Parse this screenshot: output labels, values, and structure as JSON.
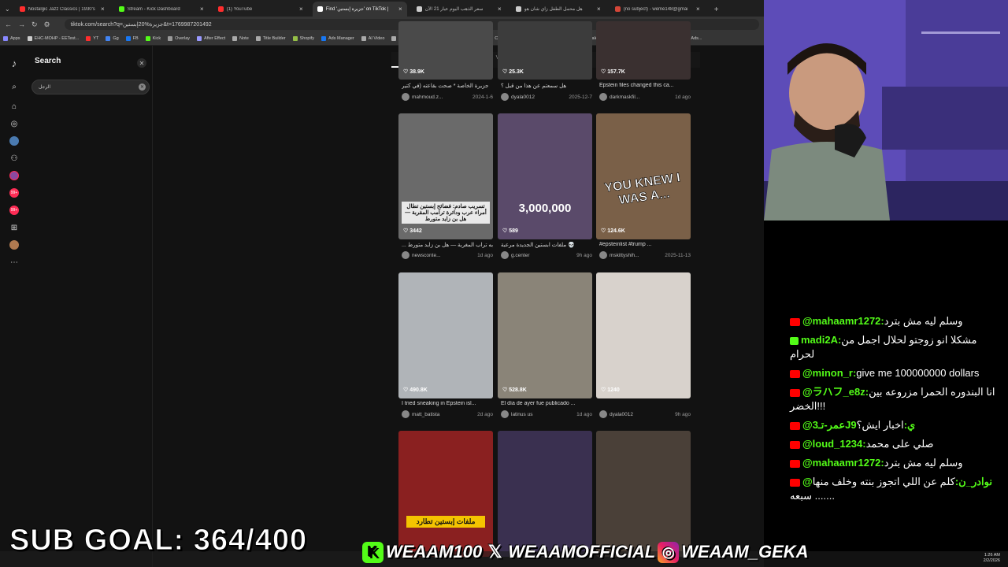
{
  "browser": {
    "tabs": [
      {
        "title": "Nostalgic Jazz Classics | 1930's",
        "color": "#ff2d2d",
        "active": false
      },
      {
        "title": "Stream - Kick Dashboard",
        "color": "#53fc18",
        "active": false
      },
      {
        "title": "(1) YouTube",
        "color": "#ff2d2d",
        "active": false
      },
      {
        "title": "Find 'جزيرة إبستين' on TikTok |",
        "color": "#ffffff",
        "active": true
      },
      {
        "title": "سعر الذهب اليوم عيار 21 الآن",
        "color": "#cccccc",
        "active": false
      },
      {
        "title": "هل محمل الطفل زاي شان هو",
        "color": "#cccccc",
        "active": false
      },
      {
        "title": "(no subject) - weme148@gmai",
        "color": "#d44638",
        "active": false
      }
    ],
    "url": "tiktok.com/search?q=جزيرة%20إبستين&t=1769987201492",
    "bookmarks": [
      {
        "label": "Apps",
        "color": "#8888ff"
      },
      {
        "label": "EHC-MOHP - EETest...",
        "color": "#cccccc"
      },
      {
        "label": "YT",
        "color": "#ff2d2d"
      },
      {
        "label": "Gg",
        "color": "#4285f4"
      },
      {
        "label": "FB",
        "color": "#1877f2"
      },
      {
        "label": "Kick",
        "color": "#53fc18"
      },
      {
        "label": "Overlay",
        "color": "#999999"
      },
      {
        "label": "After Effect",
        "color": "#9999ff"
      },
      {
        "label": "Note",
        "color": "#aaaaaa"
      },
      {
        "label": "Title Builder",
        "color": "#aaaaaa"
      },
      {
        "label": "Shopify",
        "color": "#95bf47"
      },
      {
        "label": "Ads Manager",
        "color": "#1877f2"
      },
      {
        "label": "AI Video",
        "color": "#aaaaaa"
      },
      {
        "label": "The Business Toolkit",
        "color": "#aaaaaa"
      },
      {
        "label": "Forefront Chat",
        "color": "#aaaaaa"
      },
      {
        "label": "ChatGPT",
        "color": "#10a37f"
      },
      {
        "label": "Foreplay.co",
        "color": "#aaaaaa"
      },
      {
        "label": "AI Image Upscaler",
        "color": "#aaaaaa"
      },
      {
        "label": "Anime",
        "color": "#aaaaaa"
      },
      {
        "label": "Behance",
        "color": "#1769ff"
      },
      {
        "label": "Facebook Ads...",
        "color": "#1877f2"
      }
    ]
  },
  "tiktok": {
    "search_title": "Search",
    "search_value": "الرجل",
    "result_tabs": [
      "Top",
      "Users",
      "Videos",
      "LIVE"
    ],
    "videos": [
      {
        "likes": "38.9K",
        "caption": "جزيرة الخاصة * صحت بقاعته (في كتير",
        "user": "mahmoud.z...",
        "date": "2024-1-6",
        "bg": "#4a4a4a"
      },
      {
        "likes": "25.3K",
        "caption": "هل سمعتم عن هذا من قبل ؟",
        "user": "dyala0012",
        "date": "2025-12-7",
        "bg": "#3c3c3c"
      },
      {
        "likes": "157.7K",
        "caption": "Epstein files changed this ca...",
        "user": "darkmaskfil...",
        "date": "1d ago",
        "bg": "#3a3030"
      },
      {
        "likes": "3442",
        "caption": "... به تراب المغربة — هل بن زايد متورط",
        "user": "newsconte...",
        "date": "1d ago",
        "bg": "#6a6a6a",
        "overlay": "تسريب صادم: فضائح إبستين تطال أمراء عرب ودائرة ترامب المقربة — هل بن زايد متورط"
      },
      {
        "likes": "589",
        "caption": "ملفات ابستين الجديدة مرعبة 💀",
        "user": "g.center",
        "date": "9h ago",
        "bg": "#5a4a6a",
        "overlay": "3,000,000"
      },
      {
        "likes": "124.6K",
        "caption": "#epsteinlist #trump ...",
        "user": "mskittyshih...",
        "date": "2025-11-13",
        "bg": "#7a6048",
        "overlay": "YOU KNEW I WAS A..."
      },
      {
        "likes": "490.8K",
        "caption": "I tried sneaking in Epstein isl...",
        "user": "matt_batista",
        "date": "2d ago",
        "bg": "#b0b4b8"
      },
      {
        "likes": "528.8K",
        "caption": "El día de ayer fue publicado ...",
        "user": "latinus us",
        "date": "1d ago",
        "bg": "#8a8478"
      },
      {
        "likes": "1240",
        "caption": "",
        "user": "dyala0012",
        "date": "9h ago",
        "bg": "#d8d2cc"
      },
      {
        "likes": "",
        "caption": "",
        "user": "",
        "date": "",
        "bg": "#8a2020",
        "overlay": "ملفات إبستين تطارد"
      },
      {
        "likes": "",
        "caption": "",
        "user": "",
        "date": "",
        "bg": "#3a3050"
      },
      {
        "likes": "",
        "caption": "",
        "user": "",
        "date": "",
        "bg": "#4a4038"
      }
    ]
  },
  "chat": [
    {
      "platform": "yt",
      "user": "@mahaamr1272:",
      "text": "وسلم ليه مش بترد"
    },
    {
      "platform": "kick",
      "user": "madi2A:",
      "text": "مشكلا انو زوجتو لحلال اجمل من لحرام"
    },
    {
      "platform": "yt",
      "user": "@minon_r:",
      "text": "give me 100000000 dollars"
    },
    {
      "platform": "yt",
      "user": "@ラハフ_e8z:",
      "text": "انا البندوره الحمرا مزروعه بين الخضر!!!"
    },
    {
      "platform": "yt",
      "user": "@عمر-تـ3J9ي:",
      "text": "اخبار ايش؟"
    },
    {
      "platform": "yt",
      "user": "@loud_1234:",
      "text": "صلي على محمد"
    },
    {
      "platform": "yt",
      "user": "@mahaamr1272:",
      "text": "وسلم ليه مش بترد"
    },
    {
      "platform": "yt",
      "user": "@نوادر_ن:",
      "text": "كلم عن اللي اتجوز بنته وخلف منها سبعه ......."
    }
  ],
  "overlay": {
    "sub_goal": "SUB GOAL: 364/400",
    "kick_handle": "WEAAM100",
    "x_handle": "WEAAMOFFICIAL",
    "ig_handle": "WEAAM_GEKA"
  },
  "tray": {
    "time": "1:26 AM",
    "date": "2/2/2026"
  },
  "colors": {
    "kick": "#53fc18",
    "youtube": "#ff0000",
    "webcam_bg": "#6d54c4"
  }
}
